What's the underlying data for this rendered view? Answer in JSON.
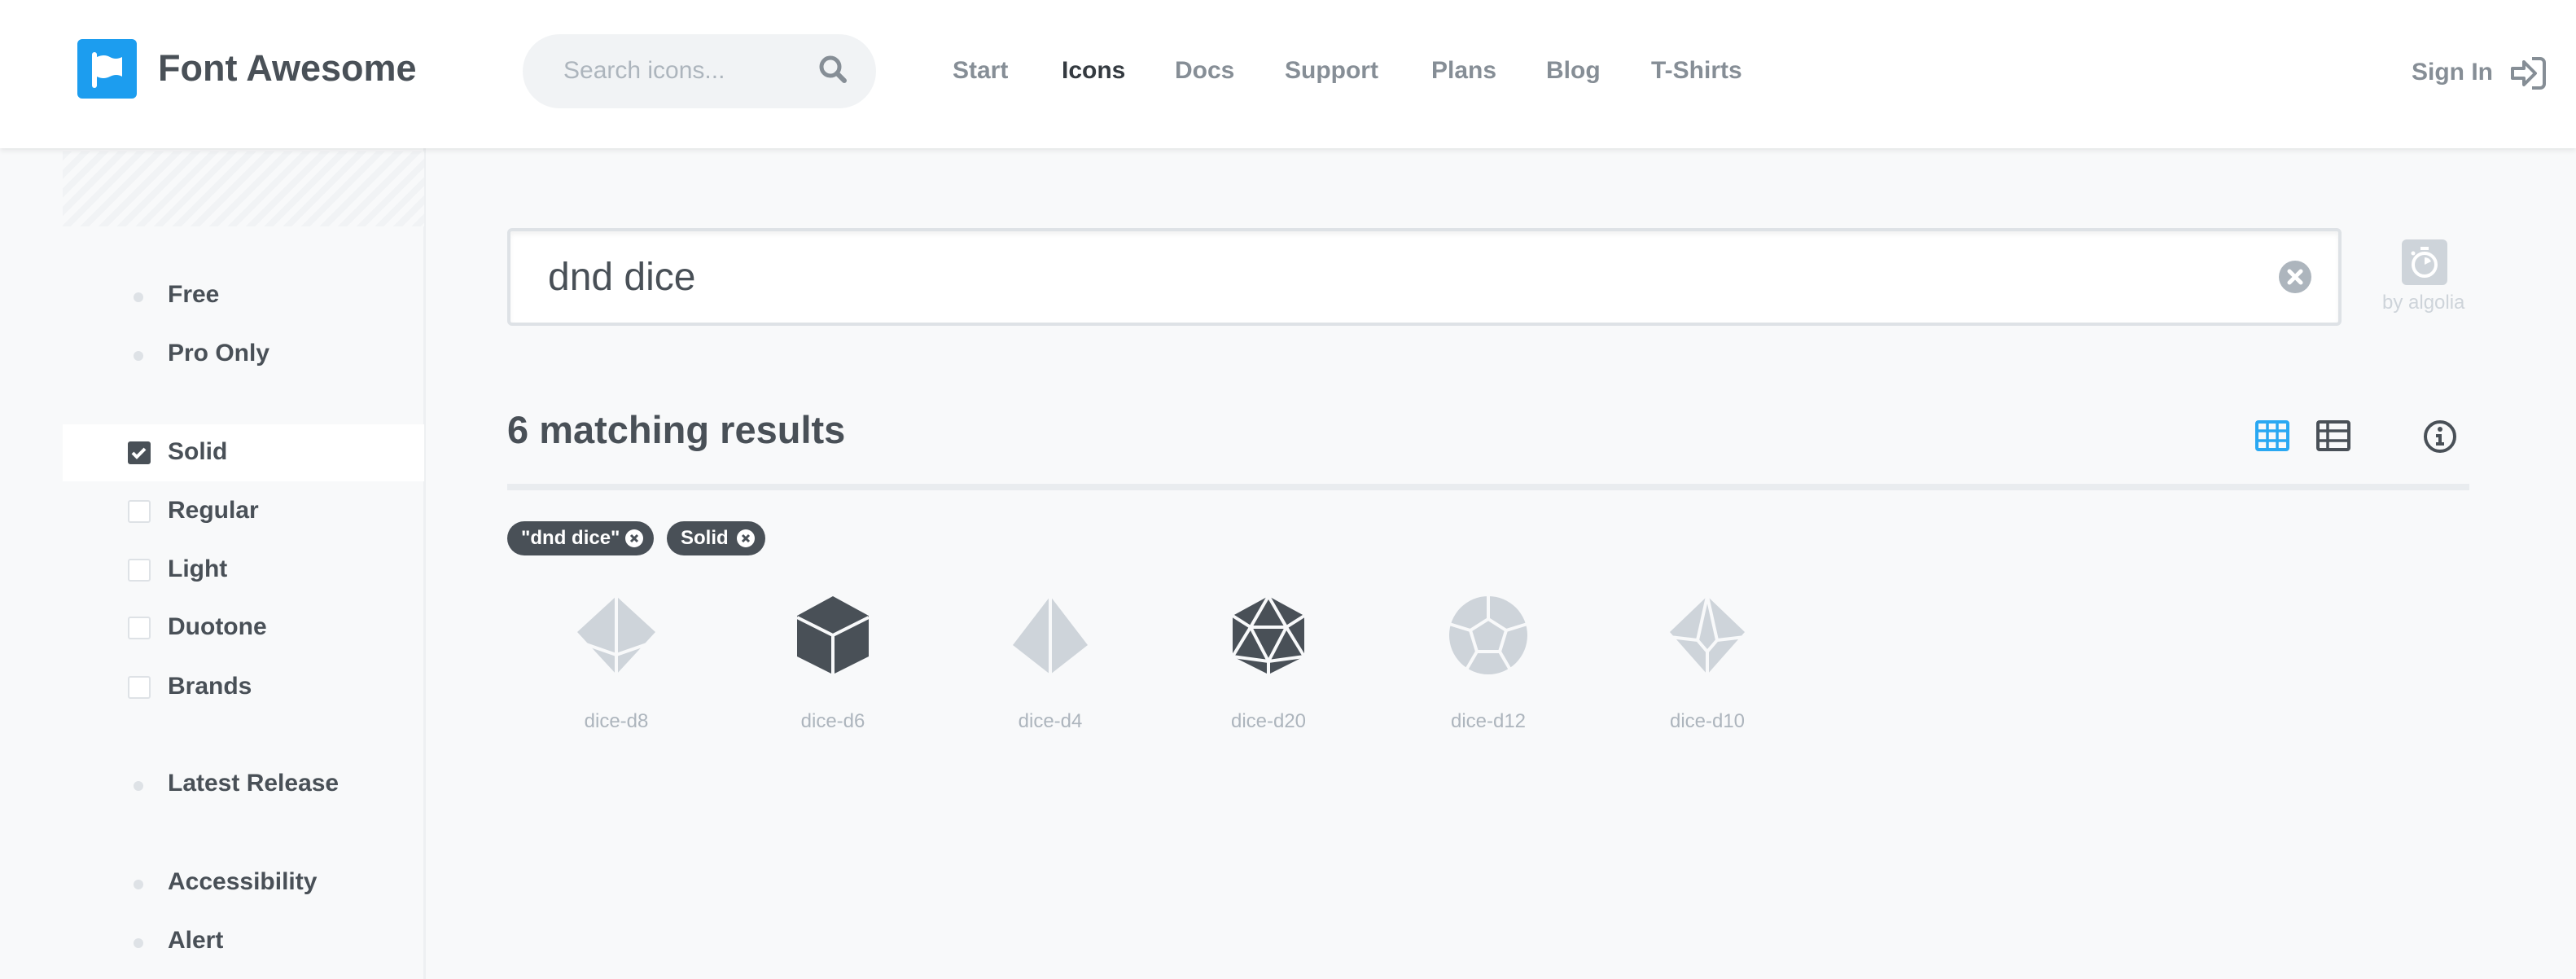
{
  "header": {
    "brand": "Font Awesome",
    "search_placeholder": "Search icons...",
    "nav": [
      "Start",
      "Icons",
      "Docs",
      "Support",
      "Plans",
      "Blog",
      "T-Shirts"
    ],
    "active_nav": "Icons",
    "sign_in": "Sign In"
  },
  "sidebar": {
    "items": [
      {
        "label": "Free",
        "type": "bullet"
      },
      {
        "label": "Pro Only",
        "type": "bullet"
      },
      {
        "label": "Solid",
        "type": "checkbox",
        "checked": true
      },
      {
        "label": "Regular",
        "type": "checkbox",
        "checked": false
      },
      {
        "label": "Light",
        "type": "checkbox",
        "checked": false
      },
      {
        "label": "Duotone",
        "type": "checkbox",
        "checked": false
      },
      {
        "label": "Brands",
        "type": "checkbox",
        "checked": false
      },
      {
        "label": "Latest Release",
        "type": "bullet"
      },
      {
        "label": "Accessibility",
        "type": "bullet"
      },
      {
        "label": "Alert",
        "type": "bullet"
      }
    ]
  },
  "main": {
    "search_value": "dnd dice",
    "algolia": "by algolia",
    "results": "6 matching results",
    "chips": [
      "\"dnd dice\"",
      "Solid"
    ],
    "icons": [
      {
        "name": "dice-d8",
        "available": false
      },
      {
        "name": "dice-d6",
        "available": true
      },
      {
        "name": "dice-d4",
        "available": false
      },
      {
        "name": "dice-d20",
        "available": true
      },
      {
        "name": "dice-d12",
        "available": false
      },
      {
        "name": "dice-d10",
        "available": false
      }
    ]
  },
  "colors": {
    "brand": "#1c9def",
    "text": "#495057",
    "muted": "#adb5bd",
    "disabled_icon": "#ced4da",
    "active_view": "#2aa8f2"
  }
}
